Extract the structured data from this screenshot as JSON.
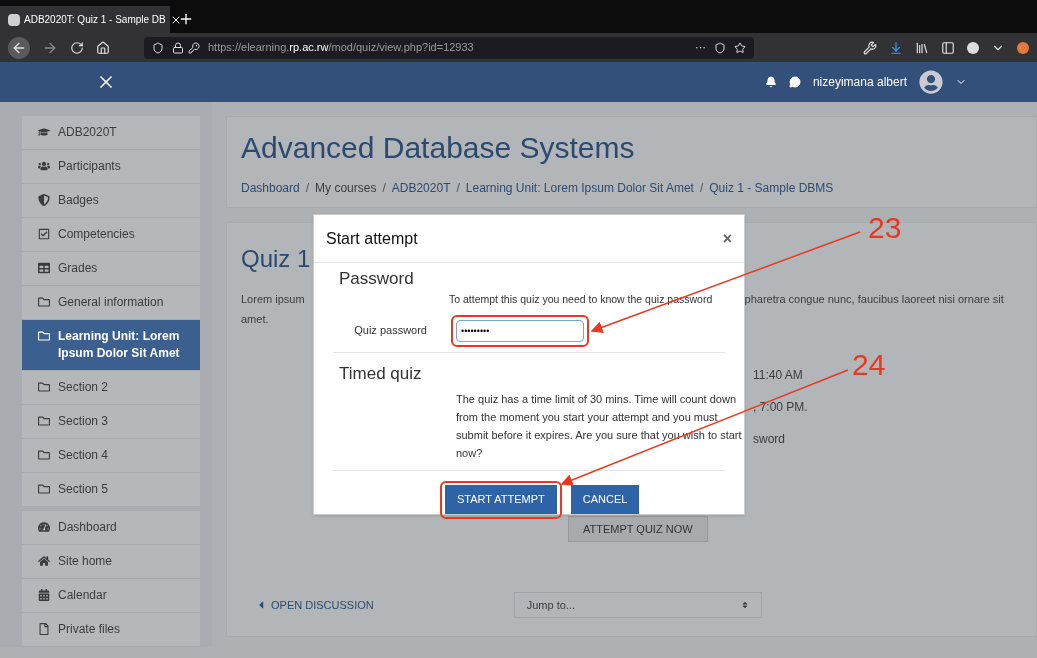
{
  "browser": {
    "tab_title": "ADB2020T: Quiz 1 - Sample DB",
    "url_prefix": "https://elearning.",
    "url_domain": "rp.ac.rw",
    "url_path": "/mod/quiz/view.php?id=12933",
    "more": "···"
  },
  "navbar": {
    "user": "nizeyimana albert"
  },
  "sidebar": {
    "items": [
      {
        "label": "ADB2020T",
        "kind": "course",
        "selected": false
      },
      {
        "label": "Participants",
        "kind": "people",
        "selected": false
      },
      {
        "label": "Badges",
        "kind": "badge",
        "selected": false
      },
      {
        "label": "Competencies",
        "kind": "check",
        "selected": false
      },
      {
        "label": "Grades",
        "kind": "grid",
        "selected": false
      },
      {
        "label": "General information",
        "kind": "folder",
        "selected": false
      },
      {
        "label": "Learning Unit: Lorem Ipsum Dolor Sit Amet",
        "kind": "folder",
        "selected": true
      },
      {
        "label": "Section 2",
        "kind": "folder",
        "selected": false
      },
      {
        "label": "Section 3",
        "kind": "folder",
        "selected": false
      },
      {
        "label": "Section 4",
        "kind": "folder",
        "selected": false
      },
      {
        "label": "Section 5",
        "kind": "folder",
        "selected": false
      }
    ],
    "site_items": [
      {
        "label": "Dashboard",
        "kind": "dashboard",
        "selected": false
      },
      {
        "label": "Site home",
        "kind": "home",
        "selected": false
      },
      {
        "label": "Calendar",
        "kind": "calendar",
        "selected": false
      },
      {
        "label": "Private files",
        "kind": "file",
        "selected": false
      }
    ]
  },
  "header": {
    "title": "Advanced Database Systems",
    "separator": "/",
    "breadcrumbs": [
      "Dashboard",
      "My courses",
      "ADB2020T",
      "Learning Unit: Lorem Ipsum Dolor Sit Amet",
      "Quiz 1 - Sample DBMS"
    ]
  },
  "quiz": {
    "title": "Quiz 1",
    "intro_start": "Lorem ipsum",
    "intro_end": "pharetra congue nunc, faucibus laoreet nisi ornare sit",
    "intro_line2": "amet.",
    "info_fragments": [
      "11:40 AM",
      ", 7:00 PM.",
      "sword"
    ],
    "attempt_button": "ATTEMPT QUIZ NOW",
    "prev_link": "OPEN DISCUSSION",
    "jump_placeholder": "Jump to..."
  },
  "modal": {
    "title": "Start attempt",
    "close": "×",
    "password_heading": "Password",
    "password_note": "To attempt this quiz you need to know the quiz password",
    "password_label": "Quiz password",
    "password_value": "•••••••••",
    "timed_heading": "Timed quiz",
    "timed_text": "The quiz has a time limit of 30 mins. Time will count down from the moment you start your attempt and you must submit before it expires. Are you sure that you wish to start now?",
    "buttons": [
      "START ATTEMPT",
      "CANCEL"
    ]
  },
  "annotations": [
    {
      "label": "23"
    },
    {
      "label": "24"
    }
  ]
}
